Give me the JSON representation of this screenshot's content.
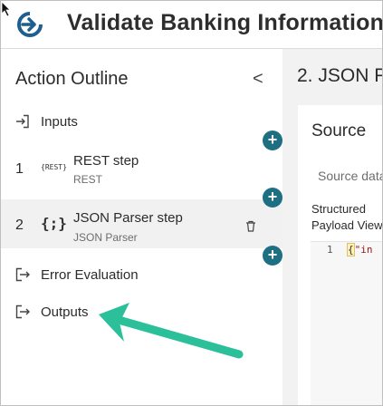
{
  "header": {
    "title": "Validate Banking Information"
  },
  "outline": {
    "title": "Action Outline",
    "collapse_glyph": "<",
    "items": [
      {
        "kind": "inputs",
        "label": "Inputs",
        "icon": "input-icon"
      },
      {
        "kind": "step",
        "number": "1",
        "label": "REST step",
        "sub": "REST",
        "icon": "rest-icon",
        "icon_text": "{REST}"
      },
      {
        "kind": "step",
        "number": "2",
        "label": "JSON Parser step",
        "sub": "JSON Parser",
        "icon": "json-parser-icon",
        "icon_text": "{;}",
        "selected": true
      },
      {
        "kind": "error",
        "label": "Error Evaluation",
        "icon": "output-icon"
      },
      {
        "kind": "outputs",
        "label": "Outputs",
        "icon": "output-icon"
      }
    ]
  },
  "connectors": {
    "glyph": "+"
  },
  "detail": {
    "step_number": "2.",
    "step_name": "JSON P",
    "source_title": "Source",
    "source_data_label": "Source data",
    "structured_line1": "Structured",
    "structured_line2": "Payload View",
    "editor": {
      "line_number": "1",
      "code_brace": "{",
      "code_text": "\"in"
    }
  },
  "colors": {
    "accent": "#1f6f82",
    "annotation_arrow": "#2bbf9a",
    "selected_row": "#f1f1f1"
  }
}
